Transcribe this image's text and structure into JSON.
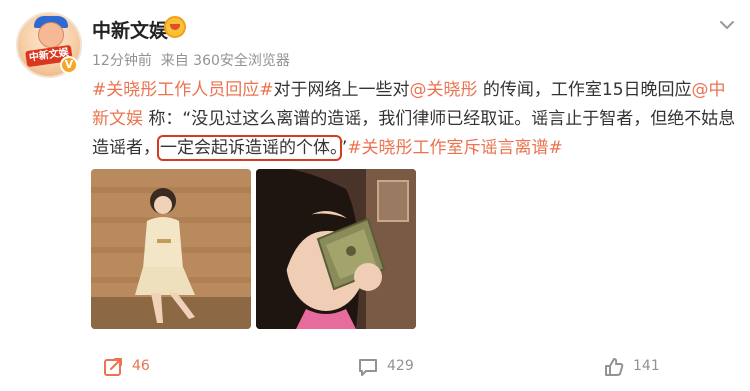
{
  "header": {
    "account_name": "中新文娱",
    "time": "12分钟前",
    "source": "来自 360安全浏览器"
  },
  "post": {
    "hashtag1": "#关晓彤工作人员回应#",
    "text1": "对于网络上一些对",
    "mention1": "@关晓彤",
    "text2": " 的传闻，工作室15日晚回应",
    "mention2": "@中新文娱",
    "text3": " 称：“没见过这么离谱的造谣，我们律师已经取证。谣言止于智者，但绝不姑息造谣者，",
    "highlight": "一定会起诉造谣的个体。",
    "text4": "”",
    "hashtag2": "#关晓彤工作室斥谣言离谱#"
  },
  "actions": {
    "share_count": "46",
    "comment_count": "429",
    "like_count": "141"
  },
  "avatar_text": "中新文娱",
  "colors": {
    "link": "#eb7350",
    "highlight_box": "#d53b22",
    "meta": "#939393"
  }
}
